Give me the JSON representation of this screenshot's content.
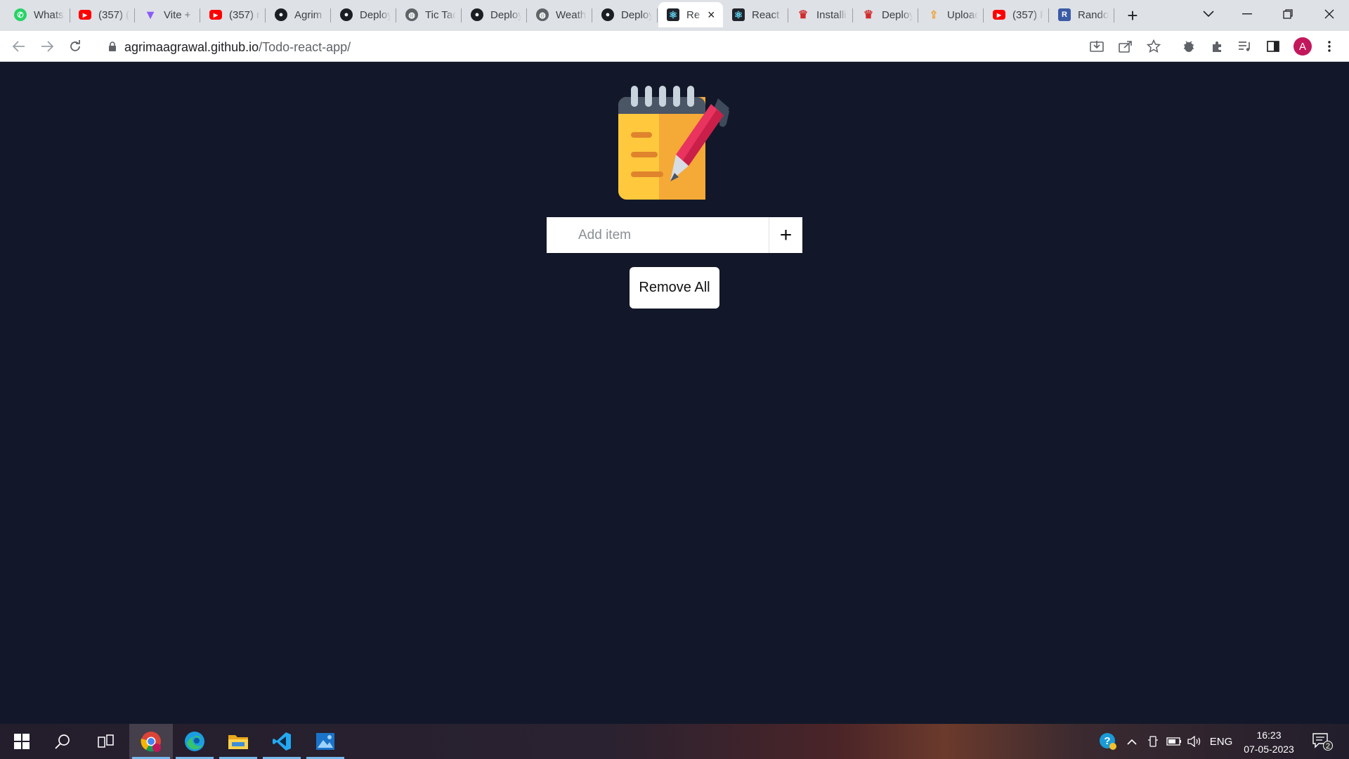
{
  "browser": {
    "tabs": [
      {
        "title": "WhatsApp",
        "icon": "whatsapp-icon",
        "active": false
      },
      {
        "title": "(357) (",
        "icon": "youtube-icon",
        "active": false
      },
      {
        "title": "Vite + ",
        "icon": "vite-icon",
        "active": false
      },
      {
        "title": "(357) r",
        "icon": "youtube-icon",
        "active": false
      },
      {
        "title": "Agrim",
        "icon": "github-icon",
        "active": false
      },
      {
        "title": "Deploy",
        "icon": "github-icon",
        "active": false
      },
      {
        "title": "Tic Tac",
        "icon": "globe-icon",
        "active": false
      },
      {
        "title": "Deploy",
        "icon": "github-icon",
        "active": false
      },
      {
        "title": "Weath",
        "icon": "globe-icon",
        "active": false
      },
      {
        "title": "Deploy",
        "icon": "github-icon",
        "active": false
      },
      {
        "title": "Re",
        "icon": "react-icon",
        "active": true
      },
      {
        "title": "React",
        "icon": "react-icon",
        "active": false
      },
      {
        "title": "Installi",
        "icon": "crown-icon",
        "active": false
      },
      {
        "title": "Deploy",
        "icon": "crown-icon",
        "active": false
      },
      {
        "title": "Upload",
        "icon": "upload-icon",
        "active": false
      },
      {
        "title": "(357) F",
        "icon": "youtube-icon",
        "active": false
      },
      {
        "title": "Rando",
        "icon": "rando-icon",
        "active": false
      }
    ],
    "active_tab_close": "×",
    "new_tab": "+",
    "url_host": "agrimaagrawal.github.io",
    "url_path": "/Todo-react-app/",
    "profile_initial": "A"
  },
  "app": {
    "input_placeholder": "Add item",
    "add_symbol": "+",
    "remove_all_label": "Remove All",
    "logo_icon": "notepad-pen-icon",
    "colors": {
      "background": "#121829",
      "notepad": "#fbbc3a",
      "pen": "#e8345e"
    }
  },
  "taskbar": {
    "apps": [
      "start-icon",
      "search-icon",
      "task-view-icon",
      "chrome-icon",
      "edge-icon",
      "file-explorer-icon",
      "vscode-icon",
      "photos-icon"
    ],
    "language": "ENG",
    "time": "16:23",
    "date": "07-05-2023",
    "notification_count": "2"
  }
}
